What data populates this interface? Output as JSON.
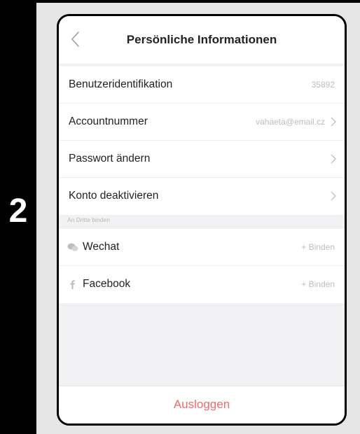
{
  "step_number": "2",
  "header": {
    "title": "Persönliche Informationen"
  },
  "account_rows": [
    {
      "label": "Benutzeridentifikation",
      "value": "35892"
    },
    {
      "label": "Accountnummer",
      "value": "vahaeta@email.cz"
    },
    {
      "label": "Passwort ändern",
      "value": ""
    },
    {
      "label": "Konto deaktivieren",
      "value": ""
    }
  ],
  "third_party": {
    "section_label": "An Dritte binden",
    "items": [
      {
        "icon": "wechat-icon",
        "label": "Wechat",
        "action": "+ Binden"
      },
      {
        "icon": "facebook-icon",
        "label": "Facebook",
        "action": "+ Binden"
      }
    ]
  },
  "footer": {
    "logout_label": "Ausloggen"
  },
  "colors": {
    "accent_red": "#ee6b6b",
    "muted_text": "#bdbdbd",
    "background": "#f2f2f4"
  }
}
